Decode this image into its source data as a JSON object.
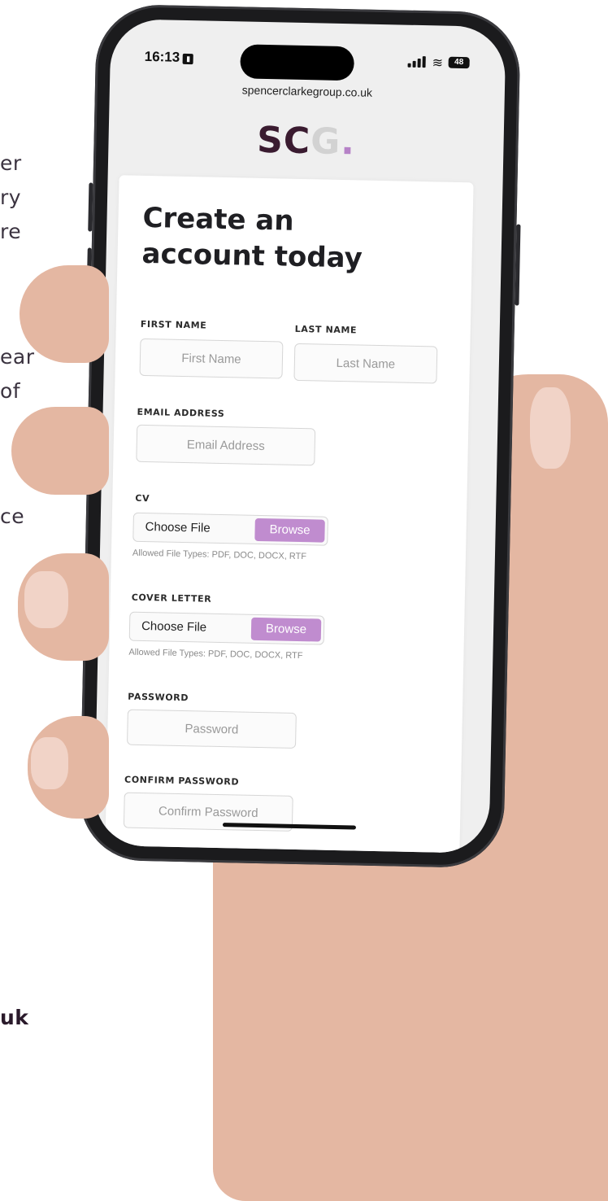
{
  "background_text": [
    "er",
    "ry",
    "re",
    "ear",
    "of",
    "ce",
    "uk"
  ],
  "status_bar": {
    "time": "16:13",
    "battery": "48"
  },
  "browser": {
    "url": "spencerclarkegroup.co.uk"
  },
  "logo": {
    "part1": "SC",
    "part2": "G",
    "dot": "."
  },
  "form": {
    "heading_line1": "Create an",
    "heading_line2": "account today",
    "first_name_label": "FIRST NAME",
    "first_name_placeholder": "First Name",
    "last_name_label": "LAST NAME",
    "last_name_placeholder": "Last Name",
    "email_label": "EMAIL ADDRESS",
    "email_placeholder": "Email Address",
    "cv_label": "CV",
    "cv_choose": "Choose File",
    "cv_browse": "Browse",
    "cv_hint": "Allowed File Types: PDF, DOC, DOCX, RTF",
    "cover_label": "COVER LETTER",
    "cover_choose": "Choose File",
    "cover_browse": "Browse",
    "cover_hint": "Allowed File Types: PDF, DOC, DOCX, RTF",
    "password_label": "PASSWORD",
    "password_placeholder": "Password",
    "confirm_label": "CONFIRM PASSWORD",
    "confirm_placeholder": "Confirm Password"
  },
  "colors": {
    "accent": "#c08ccf",
    "brand_dark": "#3a1b30",
    "skin": "#e4b7a2"
  }
}
